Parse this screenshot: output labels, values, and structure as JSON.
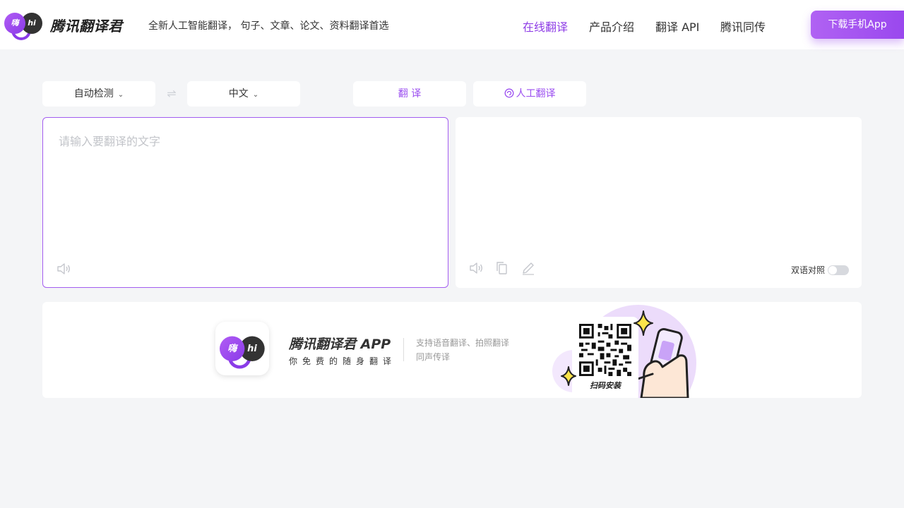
{
  "header": {
    "logo": {
      "left_char": "嗨",
      "right_char": "hi"
    },
    "brand": "腾讯翻译君",
    "slogan": "全新人工智能翻译， 句子、文章、论文、资料翻译首选",
    "nav": [
      {
        "label": "在线翻译",
        "active": true
      },
      {
        "label": "产品介绍",
        "active": false
      },
      {
        "label": "翻译 API",
        "active": false
      },
      {
        "label": "腾讯同传",
        "active": false
      }
    ],
    "download_label": "下载手机App"
  },
  "toolbar": {
    "source_lang": "自动检测",
    "target_lang": "中文",
    "translate_label": "翻 译",
    "human_translate_label": "人工翻译"
  },
  "source_panel": {
    "placeholder": "请输入要翻译的文字",
    "value": ""
  },
  "target_panel": {
    "bilingual_label": "双语对照",
    "bilingual_on": false
  },
  "promo": {
    "app_title": "腾讯翻译君 APP",
    "app_subtitle": "你免费的随身翻译",
    "features": [
      "支持语音翻译、拍照翻译",
      "同声传译"
    ],
    "qr_caption": "扫码安装"
  },
  "colors": {
    "accent": "#9b4ef0",
    "background": "#f4f5f7"
  }
}
